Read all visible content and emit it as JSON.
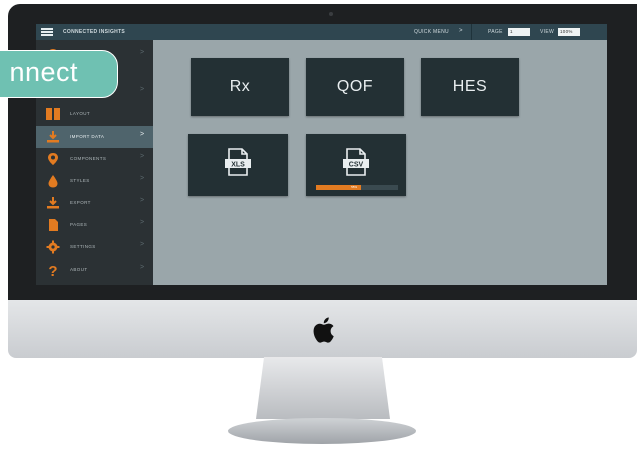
{
  "app": {
    "title": "CONNECTED INSIGHTS"
  },
  "topbar": {
    "quick_menu": "QUICK MENU",
    "quick_chevron": ">",
    "page_label": "PAGE",
    "page_value": "1",
    "view_label": "VIEW",
    "view_value": "100%"
  },
  "overlay": {
    "text": "nnect"
  },
  "sidebar": {
    "items": [
      {
        "label": "",
        "icon": "shape-icon"
      },
      {
        "label": "",
        "icon": "blank-icon"
      },
      {
        "label": "LAYOUT",
        "icon": "layout-icon"
      },
      {
        "label": "IMPORT DATA",
        "icon": "import-icon",
        "active": true
      },
      {
        "label": "COMPONENTS",
        "icon": "map-pin-icon"
      },
      {
        "label": "STYLES",
        "icon": "droplet-icon"
      },
      {
        "label": "EXPORT",
        "icon": "download-icon"
      },
      {
        "label": "PAGES",
        "icon": "page-icon"
      },
      {
        "label": "SETTINGS",
        "icon": "gear-icon"
      },
      {
        "label": "ABOUT",
        "icon": "question-icon"
      }
    ],
    "chevron": ">"
  },
  "tiles": [
    {
      "label": "Rx"
    },
    {
      "label": "QOF"
    },
    {
      "label": "HES"
    },
    {
      "label": "XLS",
      "icon": "xls-file-icon"
    },
    {
      "label": "CSV",
      "icon": "csv-file-icon",
      "progress": 0.55,
      "progress_text": "55%"
    }
  ],
  "colors": {
    "accent": "#e27b21",
    "topbar": "#2f4650",
    "sidebar": "#2b3134",
    "canvas": "#9aa6aa",
    "tile": "#233034",
    "overlay": "#6fc1b2"
  }
}
